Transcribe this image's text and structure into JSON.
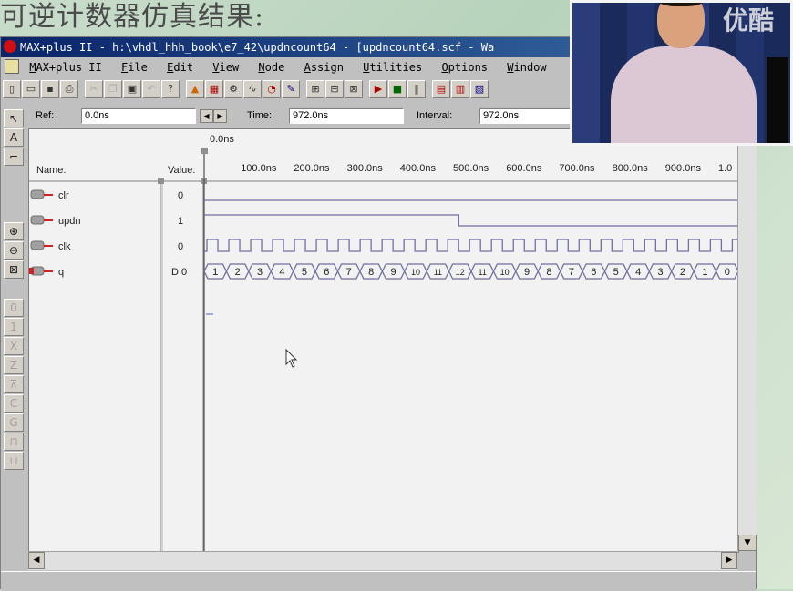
{
  "slide": {
    "title": "可逆计数器仿真结果:"
  },
  "window": {
    "title": "MAX+plus II - h:\\vhdl_hhh_book\\e7_42\\updncount64 - [updncount64.scf - Wa"
  },
  "menu": [
    "MAX+plus II",
    "File",
    "Edit",
    "View",
    "Node",
    "Assign",
    "Utilities",
    "Options",
    "Window"
  ],
  "toolbar_icons": [
    "new-file-icon",
    "open-icon",
    "save-icon",
    "print-icon",
    "cut-icon",
    "copy-icon",
    "paste-icon",
    "undo-icon",
    "help-icon",
    "hierarchy-icon",
    "floorplan-icon",
    "compiler-icon",
    "simulator-icon",
    "timing-icon",
    "programmer-icon",
    "zoom-in-icon",
    "zoom-out-icon",
    "fit-icon",
    "run-icon",
    "stop-icon",
    "pause-icon"
  ],
  "ref_bar": {
    "ref_label": "Ref:",
    "ref_value": "0.0ns",
    "time_label": "Time:",
    "time_value": "972.0ns",
    "interval_label": "Interval:",
    "interval_value": "972.0ns"
  },
  "waveform": {
    "cursor_label": "0.0ns",
    "name_header": "Name:",
    "value_header": "Value:",
    "time_ticks": [
      "100.0ns",
      "200.0ns",
      "300.0ns",
      "400.0ns",
      "500.0ns",
      "600.0ns",
      "700.0ns",
      "800.0ns",
      "900.0ns",
      "1.0"
    ],
    "signals": [
      {
        "name": "clr",
        "value": "0",
        "type": "input"
      },
      {
        "name": "updn",
        "value": "1",
        "type": "input"
      },
      {
        "name": "clk",
        "value": "0",
        "type": "input"
      },
      {
        "name": "q",
        "value": "D 0",
        "type": "output"
      }
    ],
    "q_values": [
      "1",
      "2",
      "3",
      "4",
      "5",
      "6",
      "7",
      "8",
      "9",
      "10",
      "11",
      "12",
      "11",
      "10",
      "9",
      "8",
      "7",
      "6",
      "5",
      "4",
      "3",
      "2",
      "1",
      "0"
    ],
    "clk_cycles": 25
  },
  "video_overlay": {
    "logo": "优酷"
  },
  "colors": {
    "wave": "#7070a0",
    "titlebar": "#0a246a"
  }
}
